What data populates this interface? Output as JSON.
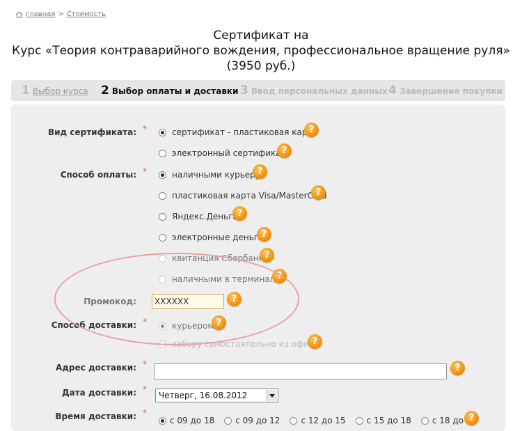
{
  "breadcrumb": {
    "home": "главная",
    "sep": ">",
    "current": "Стоимость"
  },
  "title": {
    "line1": "Сертификат на",
    "line2": "Курс «Теория контраварийного вождения, профессиональное вращение руля»",
    "line3": "(3950 руб.)"
  },
  "steps": [
    {
      "num": "1",
      "label": "Выбор курса"
    },
    {
      "num": "2",
      "label": "Выбор оплаты и доставки"
    },
    {
      "num": "3",
      "label": "Ввод персональных данных"
    },
    {
      "num": "4",
      "label": "Завершение покупки"
    }
  ],
  "form": {
    "required_mark": "*",
    "help_symbol": "?",
    "cert_type": {
      "label": "Вид сертификата:",
      "options": [
        "сертификат - пластиковая карта",
        "электронный сертификат"
      ],
      "selected": 0
    },
    "payment": {
      "label": "Способ оплаты:",
      "options": [
        "наличными курьеру",
        "пластиковая карта Visa/MasterCard",
        "Яндекс.Деньги",
        "электронные деньги",
        "квитанция Сбербанка",
        "наличными в терминале"
      ],
      "selected": 0
    },
    "promo": {
      "label": "Промокод:",
      "value": "XXXXXX"
    },
    "delivery": {
      "label": "Способ доставки:",
      "options": [
        "курьером",
        "заберу самостоятельно из офиса"
      ],
      "selected": 0
    },
    "address": {
      "label": "Адрес доставки:",
      "value": ""
    },
    "date": {
      "label": "Дата доставки:",
      "value": "Четверг, 16.08.2012"
    },
    "time": {
      "label": "Время доставки:",
      "options": [
        "с 09 до 18",
        "с 09 до 12",
        "с 12 до 15",
        "с 15 до 18",
        "с 18 до 21"
      ],
      "selected": 0
    }
  },
  "colors": {
    "accent": "#f08a00",
    "highlight": "#eaa0a0",
    "panel": "#eeeeee"
  }
}
